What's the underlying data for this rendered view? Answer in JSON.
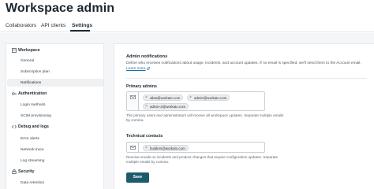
{
  "header": {
    "title": "Workspace admin",
    "tabs": [
      {
        "label": "Collaborators"
      },
      {
        "label": "API clients"
      },
      {
        "label": "Settings"
      }
    ],
    "active_tab": "Settings"
  },
  "sidebar": {
    "sections": [
      {
        "label": "Workspace",
        "icon": "workspace-icon",
        "items": [
          "General",
          "Subscription plan",
          "Notifications"
        ]
      },
      {
        "label": "Authentication",
        "icon": "key-icon",
        "items": [
          "Login methods",
          "SCIM provisioning"
        ]
      },
      {
        "label": "Debug and logs",
        "icon": "code-icon",
        "items": [
          "Error alerts",
          "Network trace",
          "Log streaming"
        ]
      },
      {
        "label": "Security",
        "icon": "lock-icon",
        "items": [
          "Data retention"
        ]
      }
    ],
    "active_item": "Notifications"
  },
  "main": {
    "title": "Admin notifications",
    "description": "Define who receives notifications about usage, incidents, and account updates. If no email is specified, we'll send them to the Account email.",
    "learn_more": "Learn more",
    "primary": {
      "label": "Primary admins",
      "emails": [
        "alias@workato.com",
        "admin@workato.com",
        "admin-2@workato.com"
      ],
      "hint": "The primary users and administrators will receive all workspace updates. Separate multiple emails by comma."
    },
    "technical": {
      "label": "Technical contacts",
      "emails": [
        "builders@workato.com"
      ],
      "hint": "Receive emails on incidents and product changes that require configuration updates. Separate multiple emails by comma."
    },
    "save_label": "Save"
  },
  "colors": {
    "accent": "#1d5b6c",
    "link": "#1b6fa8",
    "background": "#f4f5f6"
  }
}
